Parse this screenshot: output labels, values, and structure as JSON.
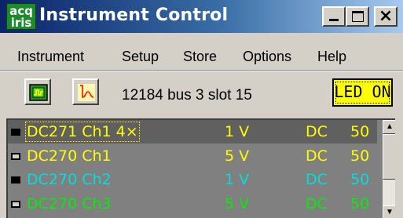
{
  "window": {
    "logo_top": "acq",
    "logo_bottom": "iris",
    "title": "Instrument Control",
    "colors": {
      "title_bar_start": "#0a246a",
      "title_bar_end": "#a6caf0",
      "logo_bg": "#1e8a2e"
    }
  },
  "window_buttons": {
    "minimize_icon": "minimize-icon",
    "maximize_icon": "maximize-icon",
    "close_glyph": "×"
  },
  "menu": [
    "Instrument",
    "Setup",
    "Store",
    "Options",
    "Help"
  ],
  "toolbar": {
    "btn1_icon": "acquire-icon",
    "btn2_icon": "waveform-icon",
    "instrument_id": "12184 bus 3 slot 15",
    "led_label": "LED ON",
    "led_color": "#ffff00"
  },
  "channels": [
    {
      "name": "DC271 Ch1 4×",
      "range": "1 V",
      "coupling": "DC",
      "impedance": "50",
      "checked": true,
      "selected": true,
      "color": "#ffff00"
    },
    {
      "name": "DC270 Ch1",
      "range": "5 V",
      "coupling": "DC",
      "impedance": "50",
      "checked": false,
      "selected": false,
      "color": "#ffff00"
    },
    {
      "name": "DC270 Ch2",
      "range": "1 V",
      "coupling": "DC",
      "impedance": "50",
      "checked": true,
      "selected": false,
      "color": "#00dddd"
    },
    {
      "name": "DC270 Ch3",
      "range": "5 V",
      "coupling": "DC",
      "impedance": "50",
      "checked": false,
      "selected": false,
      "color": "#00ee00"
    }
  ]
}
